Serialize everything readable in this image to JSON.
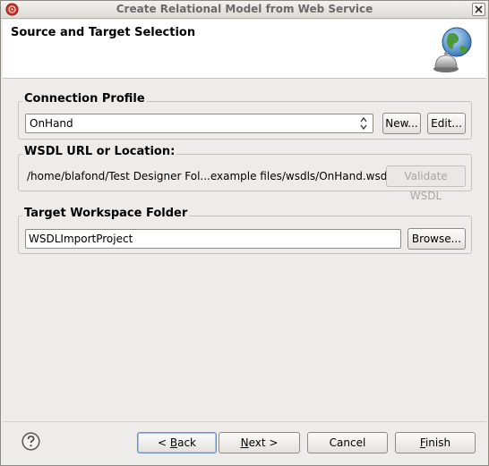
{
  "window": {
    "title": "Create Relational Model from Web Service"
  },
  "banner": {
    "title": "Source and Target Selection"
  },
  "connection_profile": {
    "label": "Connection Profile",
    "selected": "OnHand",
    "new_button": "New...",
    "edit_button": "Edit..."
  },
  "wsdl": {
    "label": "WSDL URL or Location:",
    "value": "/home/blafond/Test Designer Fol...example files/wsdls/OnHand.wsdl",
    "validate_button": "Validate WSDL"
  },
  "target_folder": {
    "label": "Target Workspace Folder",
    "value": "WSDLImportProject",
    "browse_button": "Browse..."
  },
  "footer": {
    "back_prefix": "< ",
    "back_mnemonic": "B",
    "back_rest": "ack",
    "next_mnemonic": "N",
    "next_rest": "ext >",
    "cancel": "Cancel",
    "finish_mnemonic": "F",
    "finish_rest": "inish"
  },
  "icons": {
    "app": "app-icon",
    "close": "close-icon",
    "banner": "globe-bell-icon",
    "combo": "combo-arrows-icon",
    "help": "help-icon"
  }
}
